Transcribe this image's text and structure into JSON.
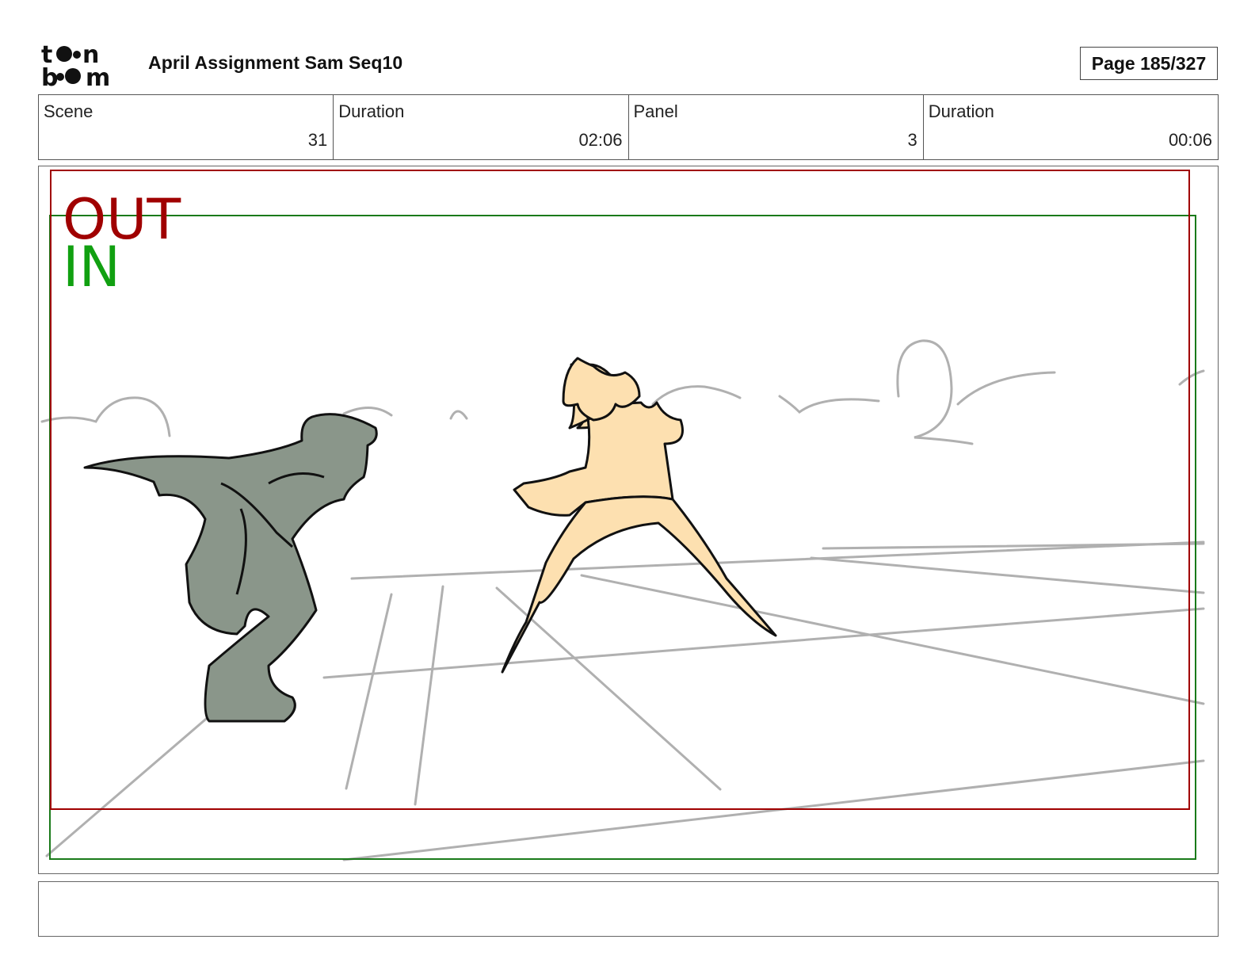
{
  "header": {
    "logo_text": "toon boom",
    "project_title": "April Assignment Sam Seq10",
    "page_label": "Page 185/327"
  },
  "info": {
    "scene_label": "Scene",
    "scene_value": "31",
    "scene_duration_label": "Duration",
    "scene_duration_value": "02:06",
    "panel_label": "Panel",
    "panel_value": "3",
    "panel_duration_label": "Duration",
    "panel_duration_value": "00:06"
  },
  "panel": {
    "out_label": "OUT",
    "in_label": "IN",
    "colors": {
      "out_frame": "#a00000",
      "in_frame": "#1a7a1a",
      "shadow_figure": "#8a968a",
      "lit_figure": "#fde0b0",
      "sketch_lines": "#b0b0b0"
    }
  },
  "notes": {
    "text": ""
  }
}
